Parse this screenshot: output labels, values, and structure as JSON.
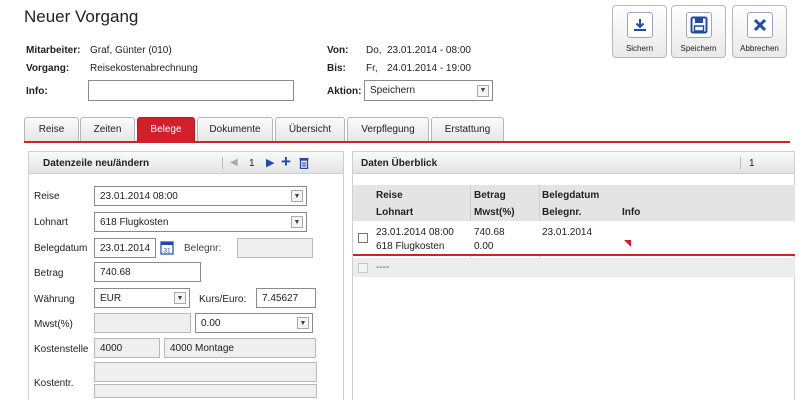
{
  "window": {
    "title": "Neuer Vorgang"
  },
  "header": {
    "mitarbeiter_label": "Mitarbeiter:",
    "mitarbeiter_value": "Graf, Günter (010)",
    "vorgang_label": "Vorgang:",
    "vorgang_value": "Reisekostenabrechnung",
    "info_label": "Info:",
    "info_value": "",
    "von_label": "Von:",
    "von_day": "Do,",
    "von_value": "23.01.2014 - 08:00",
    "bis_label": "Bis:",
    "bis_day": "Fr,",
    "bis_value": "24.01.2014 - 19:00",
    "aktion_label": "Aktion:",
    "aktion_value": "Speichern"
  },
  "toolbar": {
    "sichern_label": "Sichern",
    "speichern_label": "Speichern",
    "abbrechen_label": "Abbrechen",
    "icons": [
      "download-icon",
      "floppy-disk-icon",
      "close-icon"
    ]
  },
  "tabs": [
    "Reise",
    "Zeiten",
    "Belege",
    "Dokumente",
    "Übersicht",
    "Verpflegung",
    "Erstattung"
  ],
  "active_tab": "Belege",
  "left_panel": {
    "title": "Datenzeile neu/ändern",
    "page": "1",
    "fields": {
      "reise_label": "Reise",
      "reise_value": "23.01.2014 08:00",
      "lohnart_label": "Lohnart",
      "lohnart_value": "618 Flugkosten",
      "belegdatum_label": "Belegdatum",
      "belegdatum_value": "23.01.2014",
      "belegnr_label": "Belegnr:",
      "belegnr_value": "",
      "betrag_label": "Betrag",
      "betrag_value": "740.68",
      "waehrung_label": "Währung",
      "waehrung_value": "EUR",
      "kurs_label": "Kurs/Euro:",
      "kurs_value": "7.45627",
      "mwst_label": "Mwst(%)",
      "mwst_value": "",
      "mwst_select_value": "0.00",
      "kostenstelle_label": "Kostenstelle",
      "kostenstelle_code": "4000",
      "kostenstelle_name": "4000 Montage",
      "kostentr_label": "Kostentr.",
      "kostentr_value": "",
      "kostentr_value2": ""
    }
  },
  "right_panel": {
    "title": "Daten Überblick",
    "count": "1",
    "columns": {
      "reise": "Reise",
      "lohnart": "Lohnart",
      "betrag": "Betrag",
      "mwst": "Mwst(%)",
      "belegdatum": "Belegdatum",
      "belegnr": "Belegnr.",
      "info": "Info"
    },
    "rows": [
      {
        "reise": "23.01.2014 08:00",
        "lohnart": "618 Flugkosten",
        "betrag": "740.68",
        "mwst": "0.00",
        "belegdatum": "23.01.2014",
        "belegnr": "",
        "info": ""
      }
    ],
    "new_row_text": "----"
  },
  "colors": {
    "accent": "#d1202a",
    "icon_blue": "#1f4aa8"
  }
}
